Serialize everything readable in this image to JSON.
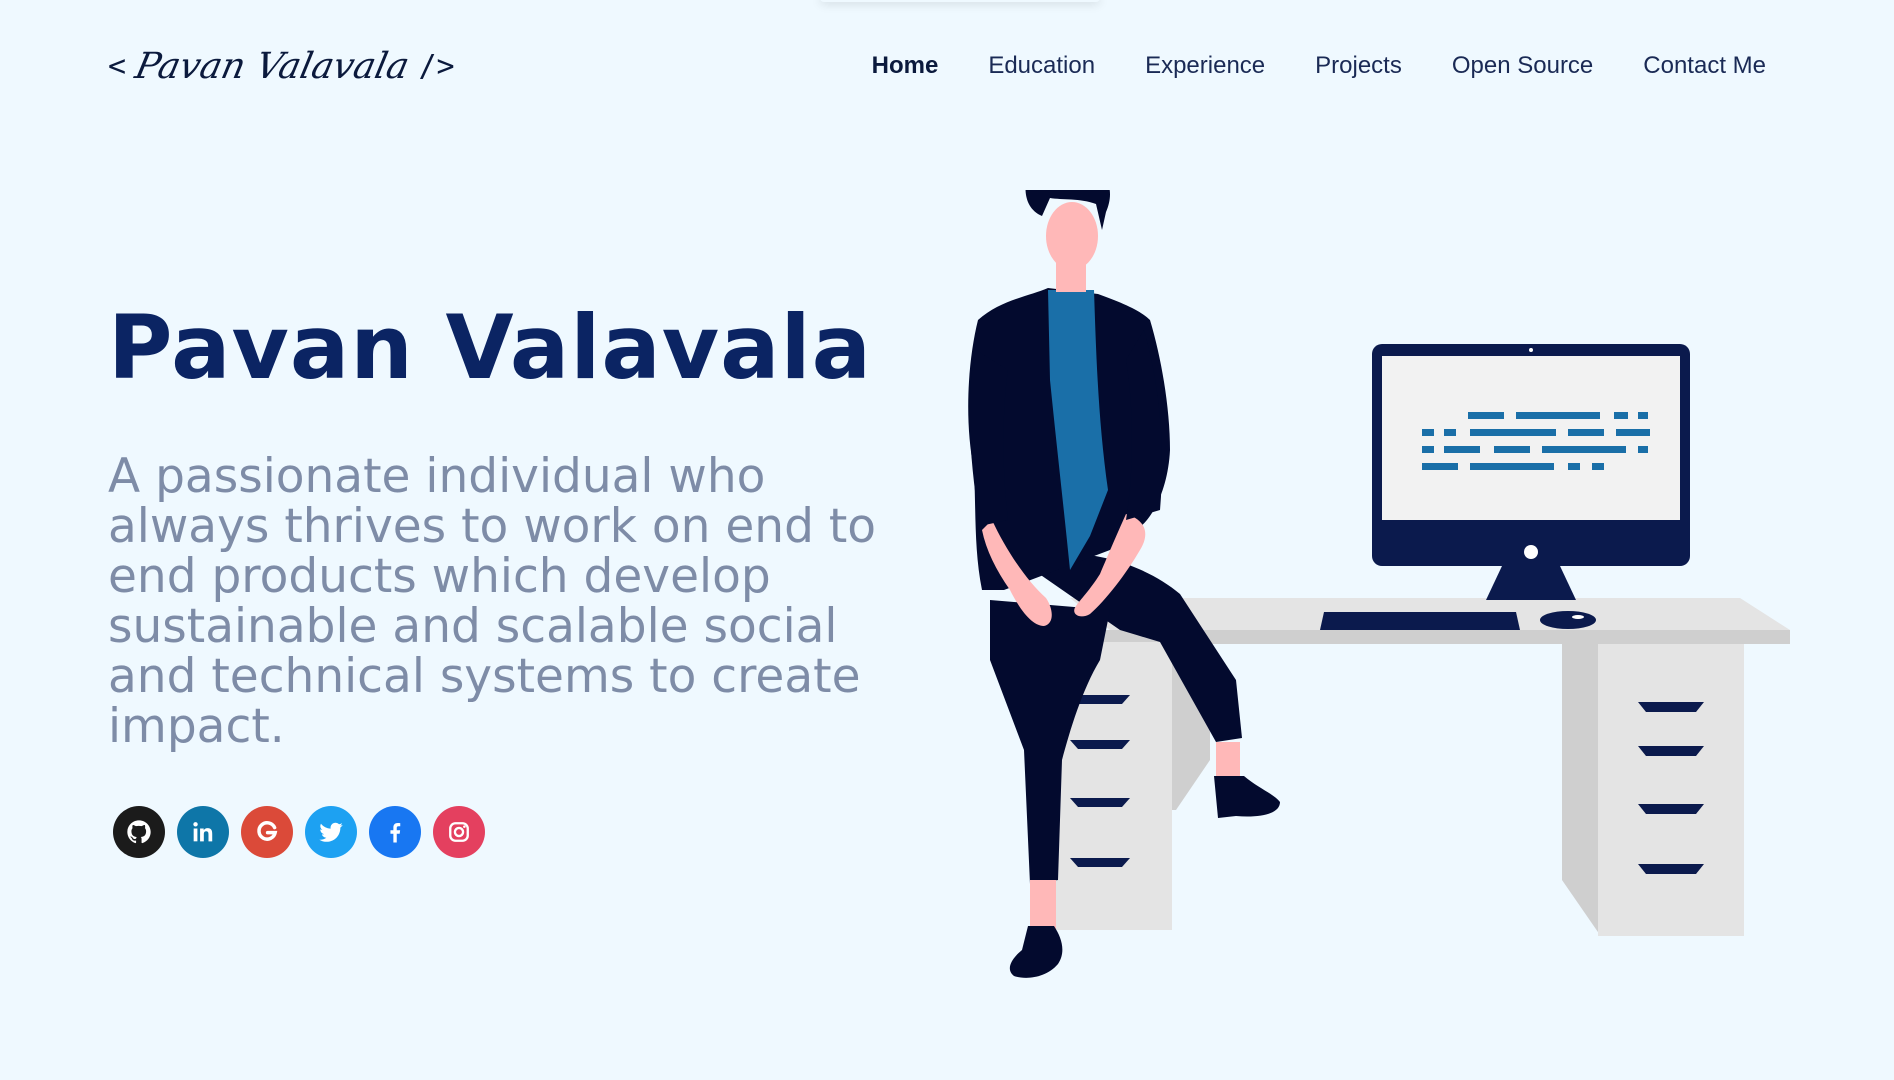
{
  "header": {
    "logo": {
      "open_bracket": "<",
      "name": "Pavan Valavala",
      "close_bracket": "/>"
    },
    "nav": [
      {
        "label": "Home",
        "active": true
      },
      {
        "label": "Education",
        "active": false
      },
      {
        "label": "Experience",
        "active": false
      },
      {
        "label": "Projects",
        "active": false
      },
      {
        "label": "Open Source",
        "active": false
      },
      {
        "label": "Contact Me",
        "active": false
      }
    ]
  },
  "hero": {
    "title": "Pavan Valavala",
    "subtitle": "A passionate individual who always thrives to work on end to end products which develop sustainable and scalable social and technical systems to create impact."
  },
  "socials": [
    {
      "icon": "github-icon",
      "color": "#1b1b1b"
    },
    {
      "icon": "linkedin-icon",
      "color": "#0e76a8"
    },
    {
      "icon": "google-icon",
      "color": "#db4a39"
    },
    {
      "icon": "twitter-icon",
      "color": "#1da1f2"
    },
    {
      "icon": "facebook-icon",
      "color": "#1877f2"
    },
    {
      "icon": "instagram-icon",
      "color": "#e4405f"
    }
  ],
  "colors": {
    "background": "#eff9ff",
    "title": "#0b2463",
    "subtitle": "#7e8ca7",
    "navy": "#030a2e",
    "shirt": "#1a6fa8",
    "skin": "#ffb8b8",
    "desk": "#e4e4e4",
    "desk_shadow": "#cfcfcf",
    "monitor": "#0b1a4d"
  }
}
